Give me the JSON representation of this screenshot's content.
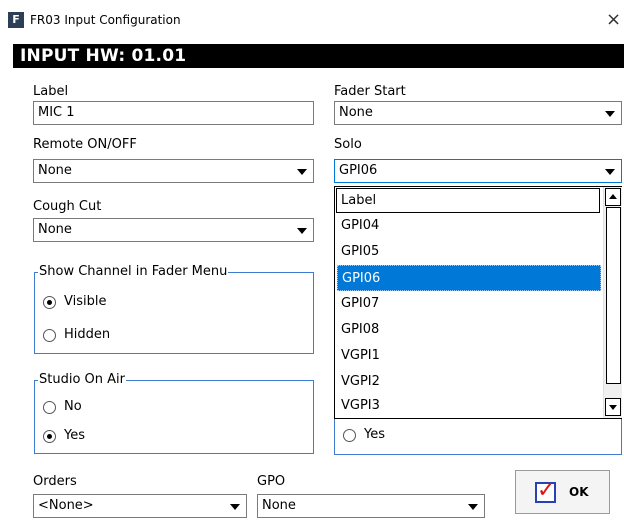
{
  "window": {
    "title": "FR03 Input Configuration",
    "app_icon": "F",
    "close_glyph": "×"
  },
  "banner": "INPUT HW: 01.01",
  "fields": {
    "label": {
      "caption": "Label",
      "value": "MIC 1"
    },
    "remote": {
      "caption": "Remote ON/OFF",
      "value": "None"
    },
    "cough": {
      "caption": "Cough Cut",
      "value": "None"
    },
    "fader_start": {
      "caption": "Fader Start",
      "value": "None"
    },
    "solo": {
      "caption": "Solo",
      "value": "GPI06"
    },
    "orders": {
      "caption": "Orders",
      "value": "<None>"
    },
    "gpo": {
      "caption": "GPO",
      "value": "None"
    }
  },
  "groups": {
    "show_channel": {
      "title": "Show Channel in Fader Menu",
      "options": [
        "Visible",
        "Hidden"
      ],
      "selected": "Visible"
    },
    "studio_on_air": {
      "title": "Studio On Air",
      "options": [
        "No",
        "Yes"
      ],
      "selected": "Yes"
    },
    "hidden_group": {
      "visible_option": "Yes"
    }
  },
  "solo_dropdown": {
    "items": [
      "Label",
      "GPI04",
      "GPI05",
      "GPI06",
      "GPI07",
      "GPI08",
      "VGPI1",
      "VGPI2",
      "VGPI3"
    ],
    "selected": "GPI06"
  },
  "ok_button": {
    "label": "OK",
    "check_glyph": "✓"
  },
  "colors": {
    "selection": "#0078d7",
    "group_border": "#3f7bd1",
    "banner_bg": "#000000",
    "check": "#e01010"
  }
}
